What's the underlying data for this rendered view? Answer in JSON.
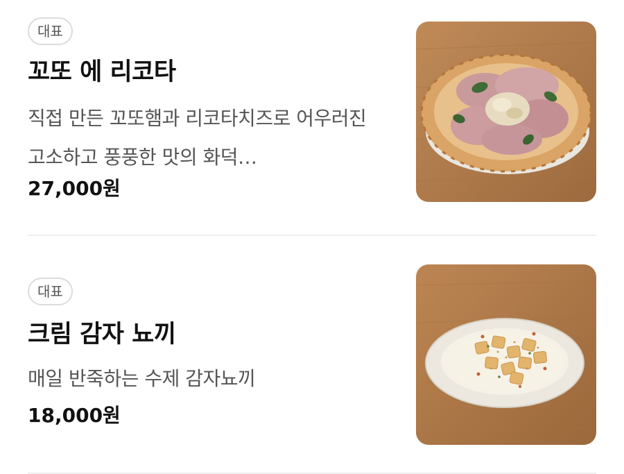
{
  "menu": {
    "items": [
      {
        "badge": "대표",
        "name": "꼬또 에 리코타",
        "description": "직접 만든 꼬또햄과 리코타치즈로 어우러진 고소하고 풍풍한 맛의 화덕…",
        "price": "27,000원",
        "image_icon": "pizza-photo"
      },
      {
        "badge": "대표",
        "name": "크림 감자 뇨끼",
        "description": "매일 반죽하는 수제 감자뇨끼",
        "price": "18,000원",
        "image_icon": "gnocchi-photo"
      }
    ]
  },
  "colors": {
    "wood": "#b07a4a",
    "badge_border": "#dcdcdc",
    "desc_text": "#555555",
    "divider": "#eeeeee"
  }
}
